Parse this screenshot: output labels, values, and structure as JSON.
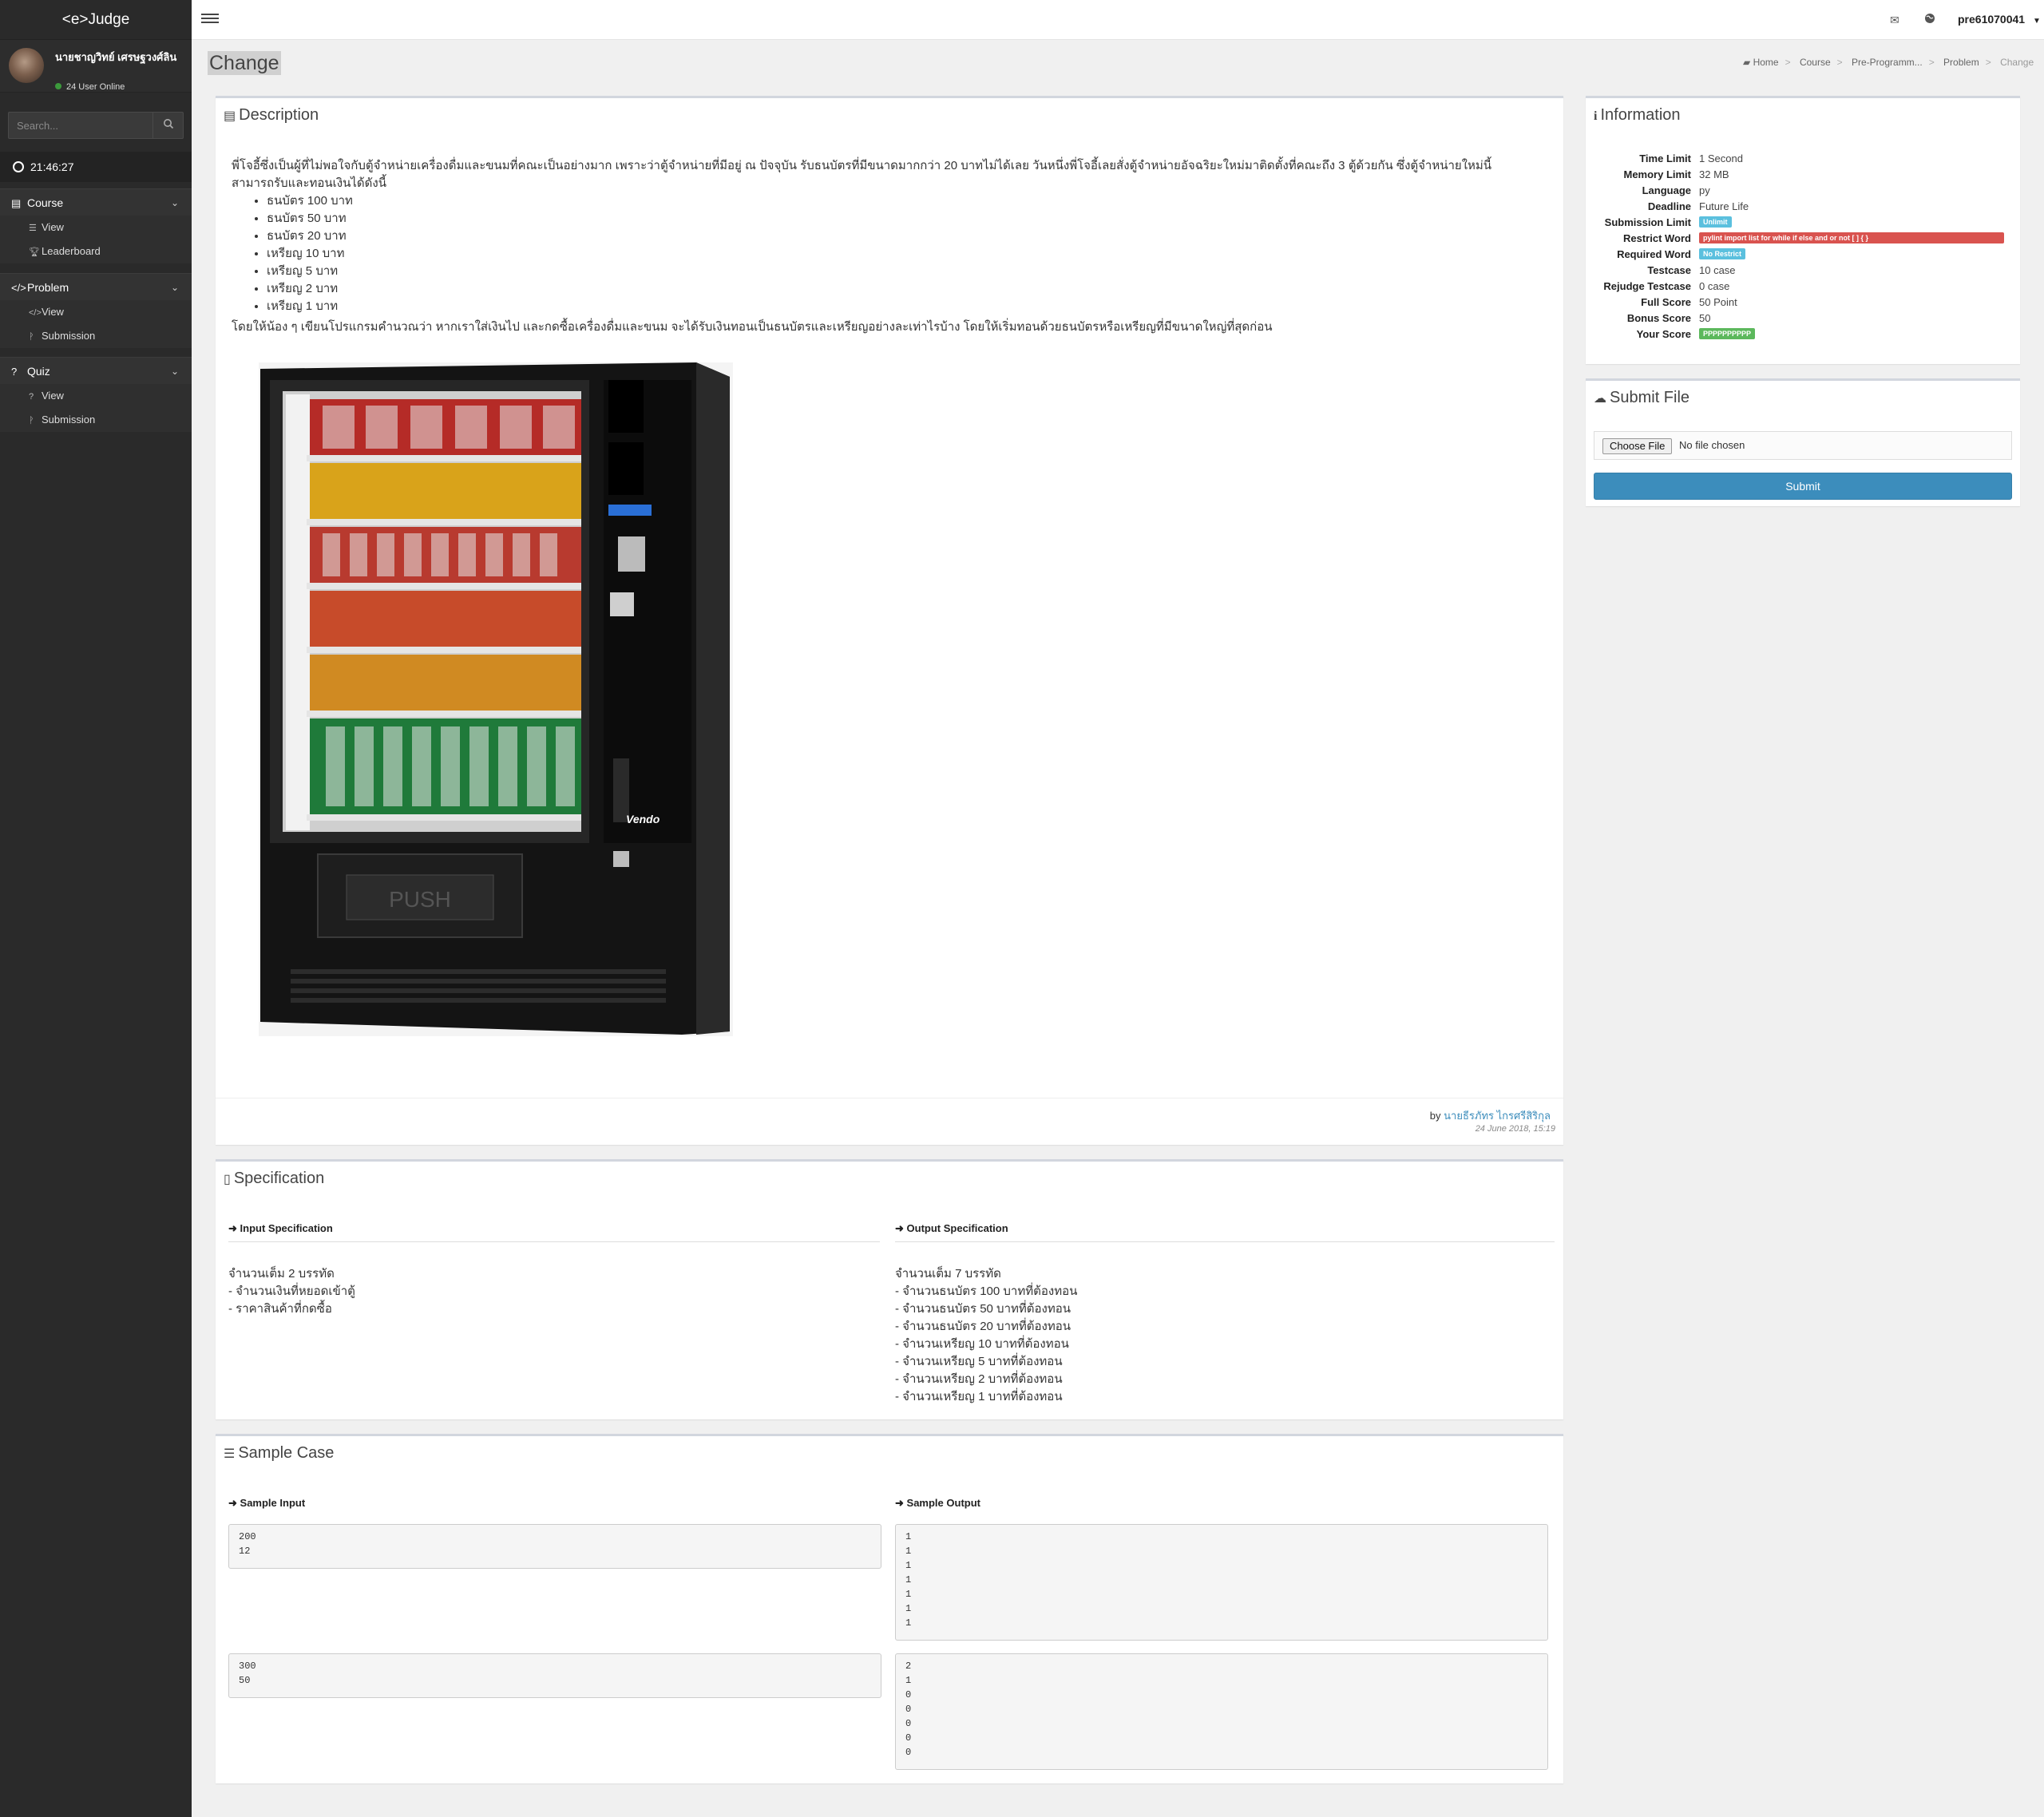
{
  "sidebar": {
    "brand": "<e>Judge",
    "user_name": "นายชาญวิทย์ เศรษฐวงศ์ลิน",
    "online_text": "24 User Online",
    "search_placeholder": "Search...",
    "clock": "21:46:27",
    "sections": [
      {
        "label": "Course",
        "items": [
          "View",
          "Leaderboard"
        ]
      },
      {
        "label": "Problem",
        "items": [
          "View",
          "Submission"
        ]
      },
      {
        "label": "Quiz",
        "items": [
          "View",
          "Submission"
        ]
      }
    ]
  },
  "topbar": {
    "user": "pre61070041"
  },
  "page": {
    "title": "Change",
    "breadcrumb": [
      "Home",
      "Course",
      "Pre-Programm...",
      "Problem",
      "Change"
    ]
  },
  "description": {
    "title": "Description",
    "intro_line1": "พี่โจอี้ซึ่งเป็นผู้ที่ไม่พอใจกับตู้จำหน่ายเครื่องดื่มและขนมที่คณะเป็นอย่างมาก เพราะว่าตู้จำหน่ายที่มีอยู่ ณ ปัจจุบัน รับธนบัตรที่มีขนาดมากกว่า 20 บาทไม่ได้เลย วันหนึ่งพี่โจอี้เลยสั่งตู้จำหน่ายอัจฉริยะใหม่มาติดตั้งที่คณะถึง 3 ตู้ด้วยกัน ซึ่งตู้จำหน่ายใหม่นี้",
    "intro_line2": "สามารถรับและทอนเงินได้ดังนี้",
    "items": [
      "ธนบัตร 100 บาท",
      "ธนบัตร 50 บาท",
      "ธนบัตร 20 บาท",
      "เหรียญ 10 บาท",
      "เหรียญ 5 บาท",
      "เหรียญ 2 บาท",
      "เหรียญ 1 บาท"
    ],
    "task": "โดยให้น้อง ๆ เขียนโปรแกรมคำนวณว่า หากเราใส่เงินไป และกดซื้อเครื่องดื่มและขนม จะได้รับเงินทอนเป็นธนบัตรและเหรียญอย่างละเท่าไรบ้าง โดยให้เริ่มทอนด้วยธนบัตรหรือเหรียญที่มีขนาดใหญ่ที่สุดก่อน",
    "machine_logo": "Vendo",
    "machine_push": "PUSH",
    "author_prefix": "by",
    "author": "นายธีรภัทร ไกรศรีสิริกุล",
    "date": "24 June 2018, 15:19"
  },
  "information": {
    "title": "Information",
    "rows": [
      {
        "label": "Time Limit",
        "value": "1 Second"
      },
      {
        "label": "Memory Limit",
        "value": "32 MB"
      },
      {
        "label": "Language",
        "value": "py"
      },
      {
        "label": "Deadline",
        "value": "Future Life"
      },
      {
        "label": "Submission Limit",
        "value": "Unlimit"
      },
      {
        "label": "Restrict Word",
        "value": "pylint import list for while if else and or not [ ] { }"
      },
      {
        "label": "Required Word",
        "value": "No Restrict"
      },
      {
        "label": "Testcase",
        "value": "10 case"
      },
      {
        "label": "Rejudge Testcase",
        "value": "0 case"
      },
      {
        "label": "Full Score",
        "value": "50 Point"
      },
      {
        "label": "Bonus Score",
        "value": "50"
      },
      {
        "label": "Your Score",
        "value": "PPPPPPPPPP"
      }
    ]
  },
  "submit": {
    "title": "Submit File",
    "choose_label": "Choose File",
    "no_file": "No file chosen",
    "submit_label": "Submit"
  },
  "specification": {
    "title": "Specification",
    "input_head": "Input Specification",
    "output_head": "Output Specification",
    "input_lines": [
      "จำนวนเต็ม 2 บรรทัด",
      "- จำนวนเงินที่หยอดเข้าตู้",
      "- ราคาสินค้าที่กดซื้อ"
    ],
    "output_lines": [
      "จำนวนเต็ม 7 บรรทัด",
      "- จำนวนธนบัตร 100 บาทที่ต้องทอน",
      "- จำนวนธนบัตร 50 บาทที่ต้องทอน",
      "- จำนวนธนบัตร 20 บาทที่ต้องทอน",
      "- จำนวนเหรียญ 10 บาทที่ต้องทอน",
      "- จำนวนเหรียญ 5 บาทที่ต้องทอน",
      "- จำนวนเหรียญ 2 บาทที่ต้องทอน",
      "- จำนวนเหรียญ 1 บาทที่ต้องทอน"
    ]
  },
  "sample": {
    "title": "Sample Case",
    "input_head": "Sample Input",
    "output_head": "Sample Output",
    "cases": [
      {
        "input": "200\n12",
        "output": "1\n1\n1\n1\n1\n1\n1"
      },
      {
        "input": "300\n50",
        "output": "2\n1\n0\n0\n0\n0\n0"
      }
    ]
  }
}
